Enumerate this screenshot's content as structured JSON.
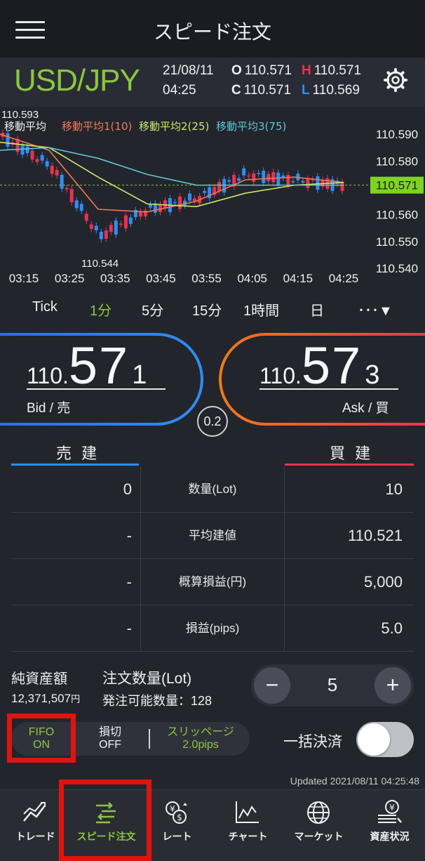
{
  "header": {
    "title": "スピード注文"
  },
  "quote": {
    "pair": "USD/JPY",
    "date": "21/08/11",
    "time": "04:25",
    "open_label": "O",
    "open": "110.571",
    "high_label": "H",
    "high": "110.571",
    "close_label": "C",
    "close": "110.571",
    "low_label": "L",
    "low": "110.569"
  },
  "chart": {
    "high_label": "110.593",
    "low_label": "110.544",
    "legend": [
      "移動平均",
      "移動平均1(10)",
      "移動平均2(25)",
      "移動平均3(75)"
    ],
    "legend_colors": [
      "#f0f0f2",
      "#f07a55",
      "#c9e86a",
      "#5cc8d8"
    ],
    "current_price": "110.571",
    "y_ticks": [
      "110.590",
      "110.580",
      "110.570",
      "110.560",
      "110.550",
      "110.540"
    ],
    "x_ticks": [
      "03:15",
      "03:25",
      "03:35",
      "03:45",
      "03:55",
      "04:05",
      "04:15",
      "04:25"
    ]
  },
  "chart_data": {
    "type": "line",
    "title": "",
    "x": [
      "03:15",
      "03:25",
      "03:35",
      "03:45",
      "03:55",
      "04:05",
      "04:15",
      "04:25"
    ],
    "ylim": [
      110.54,
      110.595
    ],
    "series": [
      {
        "name": "移動平均",
        "values": [
          110.589,
          110.578,
          110.552,
          110.562,
          110.566,
          110.575,
          110.573,
          110.571
        ]
      },
      {
        "name": "移動平均1(10)",
        "values": [
          110.59,
          110.584,
          110.562,
          110.561,
          110.565,
          110.573,
          110.574,
          110.572
        ]
      },
      {
        "name": "移動平均2(25)",
        "values": [
          110.587,
          110.585,
          110.574,
          110.564,
          110.563,
          110.568,
          110.571,
          110.572
        ]
      },
      {
        "name": "移動平均3(75)",
        "values": [
          110.584,
          110.585,
          110.581,
          110.575,
          110.571,
          110.571,
          110.571,
          110.571
        ]
      }
    ]
  },
  "timeframes": [
    "Tick",
    "1分",
    "5分",
    "15分",
    "1時間",
    "日",
    "･･･▼"
  ],
  "bid": {
    "prefix": "110.",
    "big": "57",
    "small": "1",
    "label": "Bid / 売"
  },
  "ask": {
    "prefix": "110.",
    "big": "57",
    "small": "3",
    "label": "Ask / 買"
  },
  "spread": "0.2",
  "positions": {
    "sell_header": "売 建",
    "buy_header": "買 建",
    "rows": [
      {
        "sell": "0",
        "label": "数量(Lot)",
        "buy": "10"
      },
      {
        "sell": "-",
        "label": "平均建値",
        "buy": "110.521"
      },
      {
        "sell": "-",
        "label": "概算損益(円)",
        "buy": "5,000"
      },
      {
        "sell": "-",
        "label": "損益(pips)",
        "buy": "5.0"
      }
    ]
  },
  "account": {
    "net_assets_label": "純資産額",
    "net_assets_value": "12,371,507",
    "net_assets_unit": "円",
    "order_qty_label": "注文数量(Lot)",
    "available_label": "発注可能数量：128"
  },
  "stepper": {
    "minus": "−",
    "value": "5",
    "plus": "+"
  },
  "settings": {
    "fifo_line1": "FIFO",
    "fifo_line2": "ON",
    "stop_line1": "損切",
    "stop_line2": "OFF",
    "slip_line1": "スリッページ",
    "slip_line2": "2.0pips"
  },
  "bulk_close_label": "一括決済",
  "updated": "Updated  2021/08/11 04:25:48",
  "tabs": [
    "トレード",
    "スピード注文",
    "レート",
    "チャート",
    "マーケット",
    "資産状況"
  ],
  "colors": {
    "accent": "#8cc63f",
    "bid": "#2f8df5",
    "ask": "#e8334f",
    "highlight": "#e0140e"
  }
}
